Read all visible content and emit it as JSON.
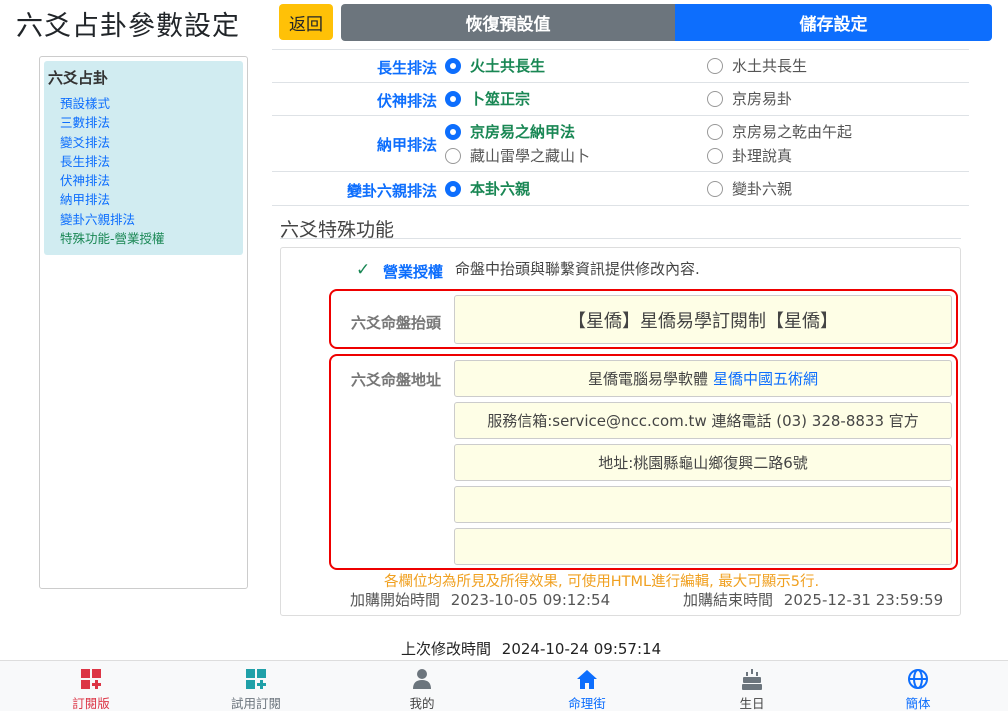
{
  "header": {
    "title": "六爻占卦參數設定",
    "back_label": "返回",
    "reset_label": "恢復預設值",
    "save_label": "儲存設定"
  },
  "sidebar": {
    "heading": "六爻占卦",
    "items": [
      {
        "label": "預設樣式"
      },
      {
        "label": "三數排法"
      },
      {
        "label": "變爻排法"
      },
      {
        "label": "長生排法"
      },
      {
        "label": "伏神排法"
      },
      {
        "label": "納甲排法"
      },
      {
        "label": "變卦六親排法"
      },
      {
        "label": "特殊功能-營業授權"
      }
    ]
  },
  "options": [
    {
      "label": "長生排法",
      "choices": [
        {
          "text": "火土共長生",
          "selected": true
        },
        {
          "text": "水土共長生",
          "selected": false
        }
      ]
    },
    {
      "label": "伏神排法",
      "choices": [
        {
          "text": "卜筮正宗",
          "selected": true
        },
        {
          "text": "京房易卦",
          "selected": false
        }
      ]
    },
    {
      "label": "納甲排法",
      "choices": [
        {
          "text": "京房易之納甲法",
          "selected": true
        },
        {
          "text": "京房易之乾由午起",
          "selected": false
        },
        {
          "text": "藏山雷學之藏山卜",
          "selected": false
        },
        {
          "text": "卦理說真",
          "selected": false
        }
      ]
    },
    {
      "label": "變卦六親排法",
      "choices": [
        {
          "text": "本卦六親",
          "selected": true
        },
        {
          "text": "變卦六親",
          "selected": false
        }
      ]
    }
  ],
  "special": {
    "section_title": "六爻特殊功能",
    "license_label": "營業授權",
    "license_desc": "命盤中抬頭與聯繫資訊提供修改內容.",
    "heading_label": "六爻命盤抬頭",
    "heading_value": "【星僑】星僑易學訂閱制【星僑】",
    "address_label": "六爻命盤地址",
    "address_lines": [
      {
        "text": "星僑電腦易學軟體",
        "link": "星僑中國五術網"
      },
      {
        "text": "服務信箱:service@ncc.com.tw 連絡電話 (03) 328-8833 官方",
        "link": ""
      },
      {
        "text": "地址:桃園縣龜山鄉復興二路6號",
        "link": ""
      },
      {
        "text": "",
        "link": ""
      },
      {
        "text": "",
        "link": ""
      }
    ],
    "hint": "各欄位均為所見及所得效果, 可使用HTML進行編輯, 最大可顯示5行.",
    "start_label": "加購開始時間",
    "start_value": "2023-10-05 09:12:54",
    "end_label": "加購結束時間",
    "end_value": "2025-12-31 23:59:59"
  },
  "footer": {
    "last_modified_label": "上次修改時間",
    "last_modified_value": "2024-10-24 09:57:14"
  },
  "bottom_nav": [
    {
      "label": "訂閱版",
      "icon": "grid-plus-icon",
      "color": "#dc3545"
    },
    {
      "label": "試用訂閱",
      "icon": "grid-plus-icon",
      "color": "#20a0a8"
    },
    {
      "label": "我的",
      "icon": "person-icon",
      "color": "#6c757d"
    },
    {
      "label": "命理街",
      "icon": "house-icon",
      "color": "#0d6efd"
    },
    {
      "label": "生日",
      "icon": "cake-icon",
      "color": "#6c757d"
    },
    {
      "label": "簡体",
      "icon": "globe-icon",
      "color": "#0d6efd"
    }
  ],
  "colors": {
    "primary": "#0d6efd",
    "warning": "#ffc107",
    "secondary": "#6c757d",
    "success": "#198754",
    "highlight": "#e00000"
  }
}
